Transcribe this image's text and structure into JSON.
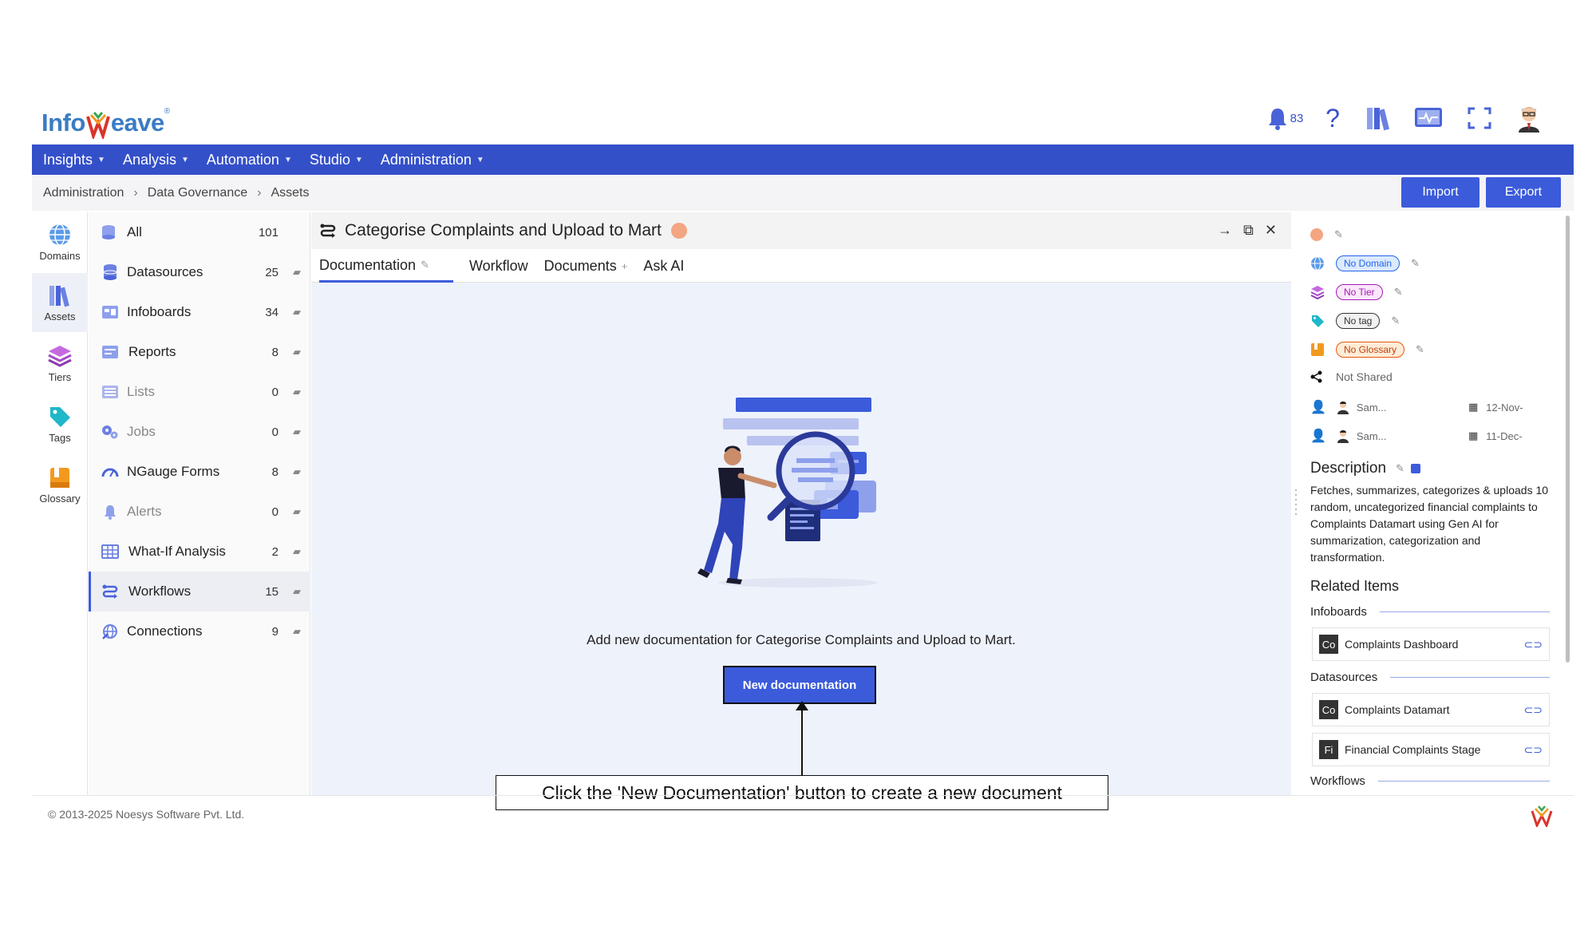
{
  "brand": {
    "logo_left": "Info",
    "logo_right": "eave",
    "registered": "®"
  },
  "header": {
    "notification_count": "83",
    "help_glyph": "?"
  },
  "nav": {
    "items": [
      "Insights",
      "Analysis",
      "Automation",
      "Studio",
      "Administration"
    ]
  },
  "breadcrumb": {
    "items": [
      "Administration",
      "Data Governance",
      "Assets"
    ]
  },
  "actions": {
    "import": "Import",
    "export": "Export"
  },
  "rail": {
    "items": [
      "Domains",
      "Assets",
      "Tiers",
      "Tags",
      "Glossary"
    ],
    "active": "Assets"
  },
  "assets": {
    "items": [
      {
        "label": "All",
        "count": "101"
      },
      {
        "label": "Datasources",
        "count": "25"
      },
      {
        "label": "Infoboards",
        "count": "34"
      },
      {
        "label": "Reports",
        "count": "8"
      },
      {
        "label": "Lists",
        "count": "0"
      },
      {
        "label": "Jobs",
        "count": "0"
      },
      {
        "label": "NGauge Forms",
        "count": "8"
      },
      {
        "label": "Alerts",
        "count": "0"
      },
      {
        "label": "What-If Analysis",
        "count": "2"
      },
      {
        "label": "Workflows",
        "count": "15"
      },
      {
        "label": "Connections",
        "count": "9"
      }
    ],
    "active": "Workflows"
  },
  "panel": {
    "title": "Categorise Complaints and Upload to Mart",
    "tabs": [
      "Documentation",
      "Workflow",
      "Documents",
      "Ask AI"
    ],
    "active_tab": "Documentation",
    "empty_message": "Add new documentation for Categorise Complaints and Upload to Mart.",
    "new_doc_button": "New documentation"
  },
  "annotation": {
    "callout": "Click the 'New Documentation' button to create a new document"
  },
  "details": {
    "domain": "No Domain",
    "tier": "No Tier",
    "tag": "No tag",
    "glossary": "No Glossary",
    "sharing": "Not Shared",
    "created_by": "Sam...",
    "created_on": "12-Nov-",
    "modified_by": "Sam...",
    "modified_on": "11-Dec-",
    "description_title": "Description",
    "description": "Fetches, summarizes, categorizes & uploads 10 random, uncategorized financial complaints to Complaints Datamart using Gen AI for summarization, categorization and transformation.",
    "related_title": "Related Items",
    "related": {
      "infoboards_label": "Infoboards",
      "infoboards": [
        {
          "badge": "Co",
          "name": "Complaints Dashboard"
        }
      ],
      "datasources_label": "Datasources",
      "datasources": [
        {
          "badge": "Co",
          "name": "Complaints Datamart"
        },
        {
          "badge": "Fi",
          "name": "Financial Complaints Stage"
        }
      ],
      "workflows_label": "Workflows"
    }
  },
  "footer": {
    "copyright": "© 2013-2025 Noesys Software Pvt. Ltd."
  },
  "colors": {
    "primary": "#3450c9",
    "button": "#3b5bdb",
    "panel_bg": "#eef2fb"
  }
}
